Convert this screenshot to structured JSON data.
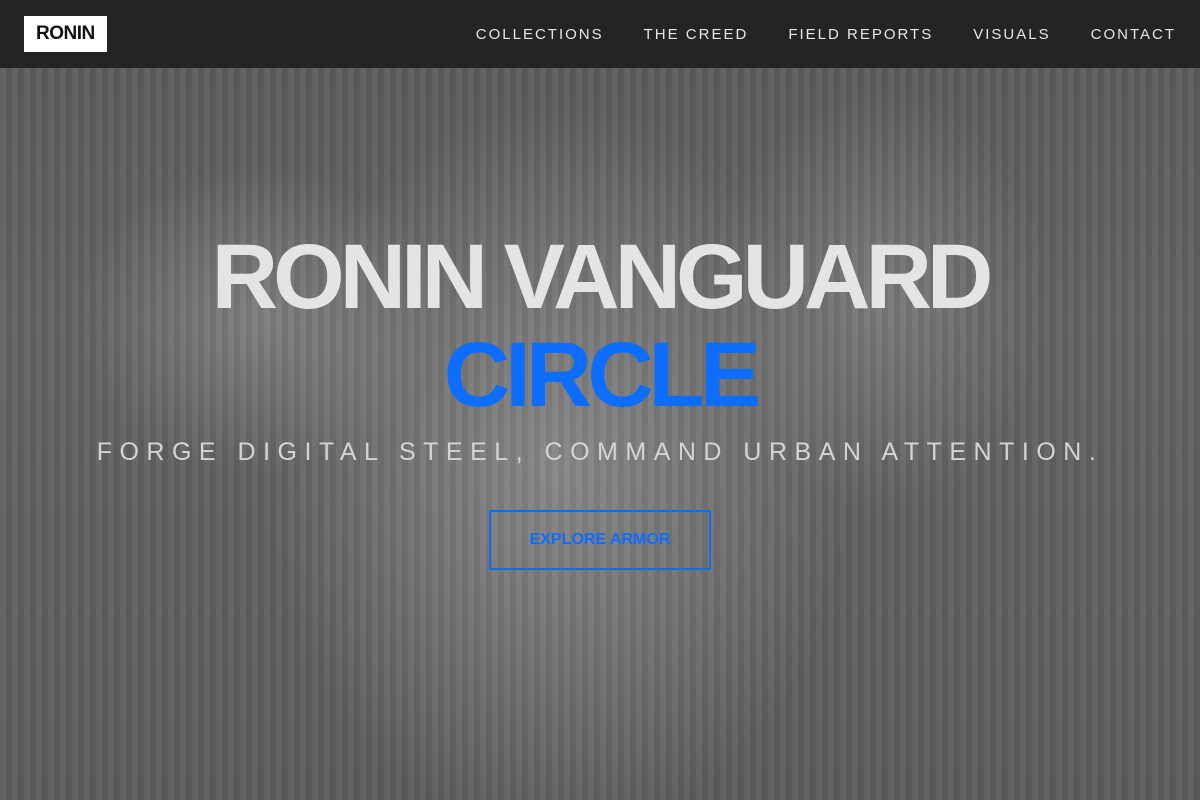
{
  "brand": {
    "logo_text": "RONIN"
  },
  "nav": {
    "items": [
      {
        "label": "COLLECTIONS"
      },
      {
        "label": "THE CREED"
      },
      {
        "label": "FIELD REPORTS"
      },
      {
        "label": "VISUALS"
      },
      {
        "label": "CONTACT"
      }
    ]
  },
  "hero": {
    "title_line1": "RONIN VANGUARD",
    "title_line2": "CIRCLE",
    "tagline": "FORGE DIGITAL STEEL, COMMAND URBAN ATTENTION.",
    "cta_label": "EXPLORE ARMOR"
  },
  "colors": {
    "accent": "#0d6efd",
    "header_bg": "#242424",
    "logo_bg": "#ffffff"
  }
}
